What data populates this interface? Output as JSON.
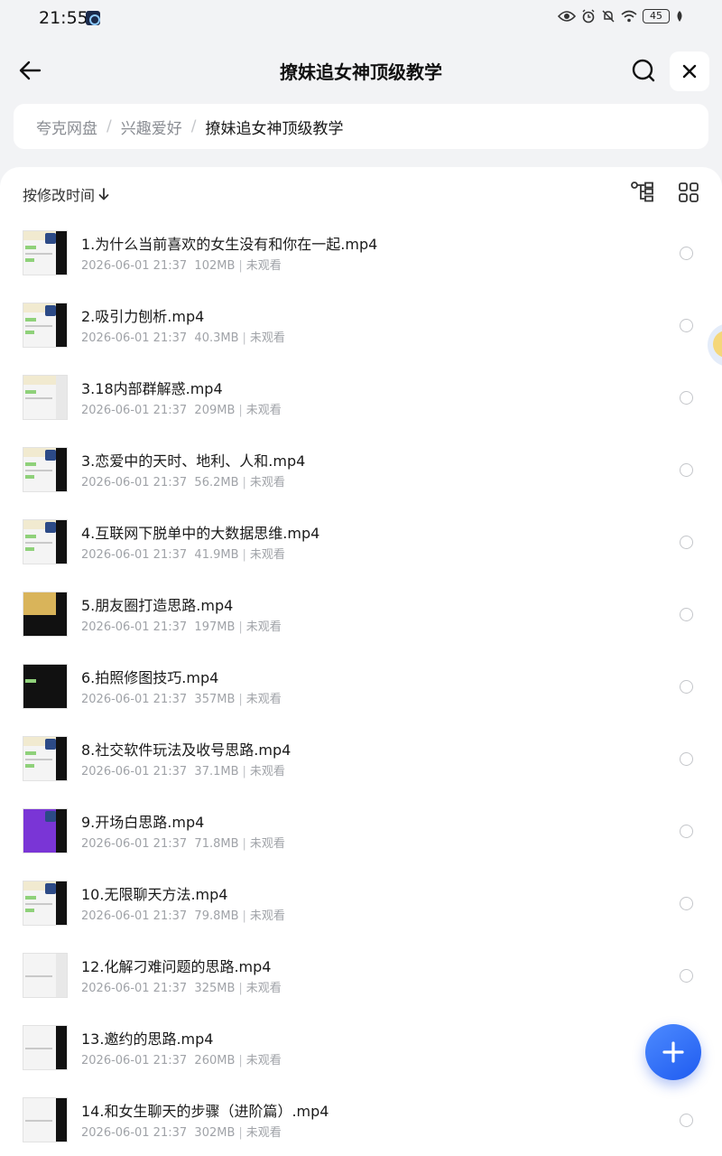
{
  "status_bar": {
    "time": "21:55",
    "battery": "45"
  },
  "header": {
    "title": "撩妹追女神顶级教学"
  },
  "breadcrumb": {
    "items": [
      "夸克网盘",
      "兴趣爱好"
    ],
    "current": "撩妹追女神顶级教学"
  },
  "toolbar": {
    "sort_label": "按修改时间"
  },
  "files": [
    {
      "name": "1.为什么当前喜欢的女生没有和你在一起.mp4",
      "date": "2026-06-01 21:37",
      "size": "102MB",
      "status": "未观看"
    },
    {
      "name": "2.吸引力刨析.mp4",
      "date": "2026-06-01 21:37",
      "size": "40.3MB",
      "status": "未观看"
    },
    {
      "name": "3.18内部群解惑.mp4",
      "date": "2026-06-01 21:37",
      "size": "209MB",
      "status": "未观看"
    },
    {
      "name": "3.恋爱中的天时、地利、人和.mp4",
      "date": "2026-06-01 21:37",
      "size": "56.2MB",
      "status": "未观看"
    },
    {
      "name": "4.互联网下脱单中的大数据思维.mp4",
      "date": "2026-06-01 21:37",
      "size": "41.9MB",
      "status": "未观看"
    },
    {
      "name": "5.朋友圈打造思路.mp4",
      "date": "2026-06-01 21:37",
      "size": "197MB",
      "status": "未观看"
    },
    {
      "name": "6.拍照修图技巧.mp4",
      "date": "2026-06-01 21:37",
      "size": "357MB",
      "status": "未观看"
    },
    {
      "name": "8.社交软件玩法及收号思路.mp4",
      "date": "2026-06-01 21:37",
      "size": "37.1MB",
      "status": "未观看"
    },
    {
      "name": "9.开场白思路.mp4",
      "date": "2026-06-01 21:37",
      "size": "71.8MB",
      "status": "未观看"
    },
    {
      "name": "10.无限聊天方法.mp4",
      "date": "2026-06-01 21:37",
      "size": "79.8MB",
      "status": "未观看"
    },
    {
      "name": "12.化解刁难问题的思路.mp4",
      "date": "2026-06-01 21:37",
      "size": "325MB",
      "status": "未观看"
    },
    {
      "name": "13.邀约的思路.mp4",
      "date": "2026-06-01 21:37",
      "size": "260MB",
      "status": "未观看"
    },
    {
      "name": "14.和女生聊天的步骤（进阶篇）.mp4",
      "date": "2026-06-01 21:37",
      "size": "302MB",
      "status": "未观看"
    }
  ],
  "icons": {
    "back": "arrow-left-icon",
    "search": "search-icon",
    "close": "close-icon",
    "sort": "arrow-down-icon",
    "tree": "tree-view-icon",
    "grid": "grid-view-icon",
    "fab": "plus-icon"
  },
  "colors": {
    "accent": "#2f6bf5",
    "background": "#f2f3f5",
    "meta_text": "#a0a3a8"
  }
}
